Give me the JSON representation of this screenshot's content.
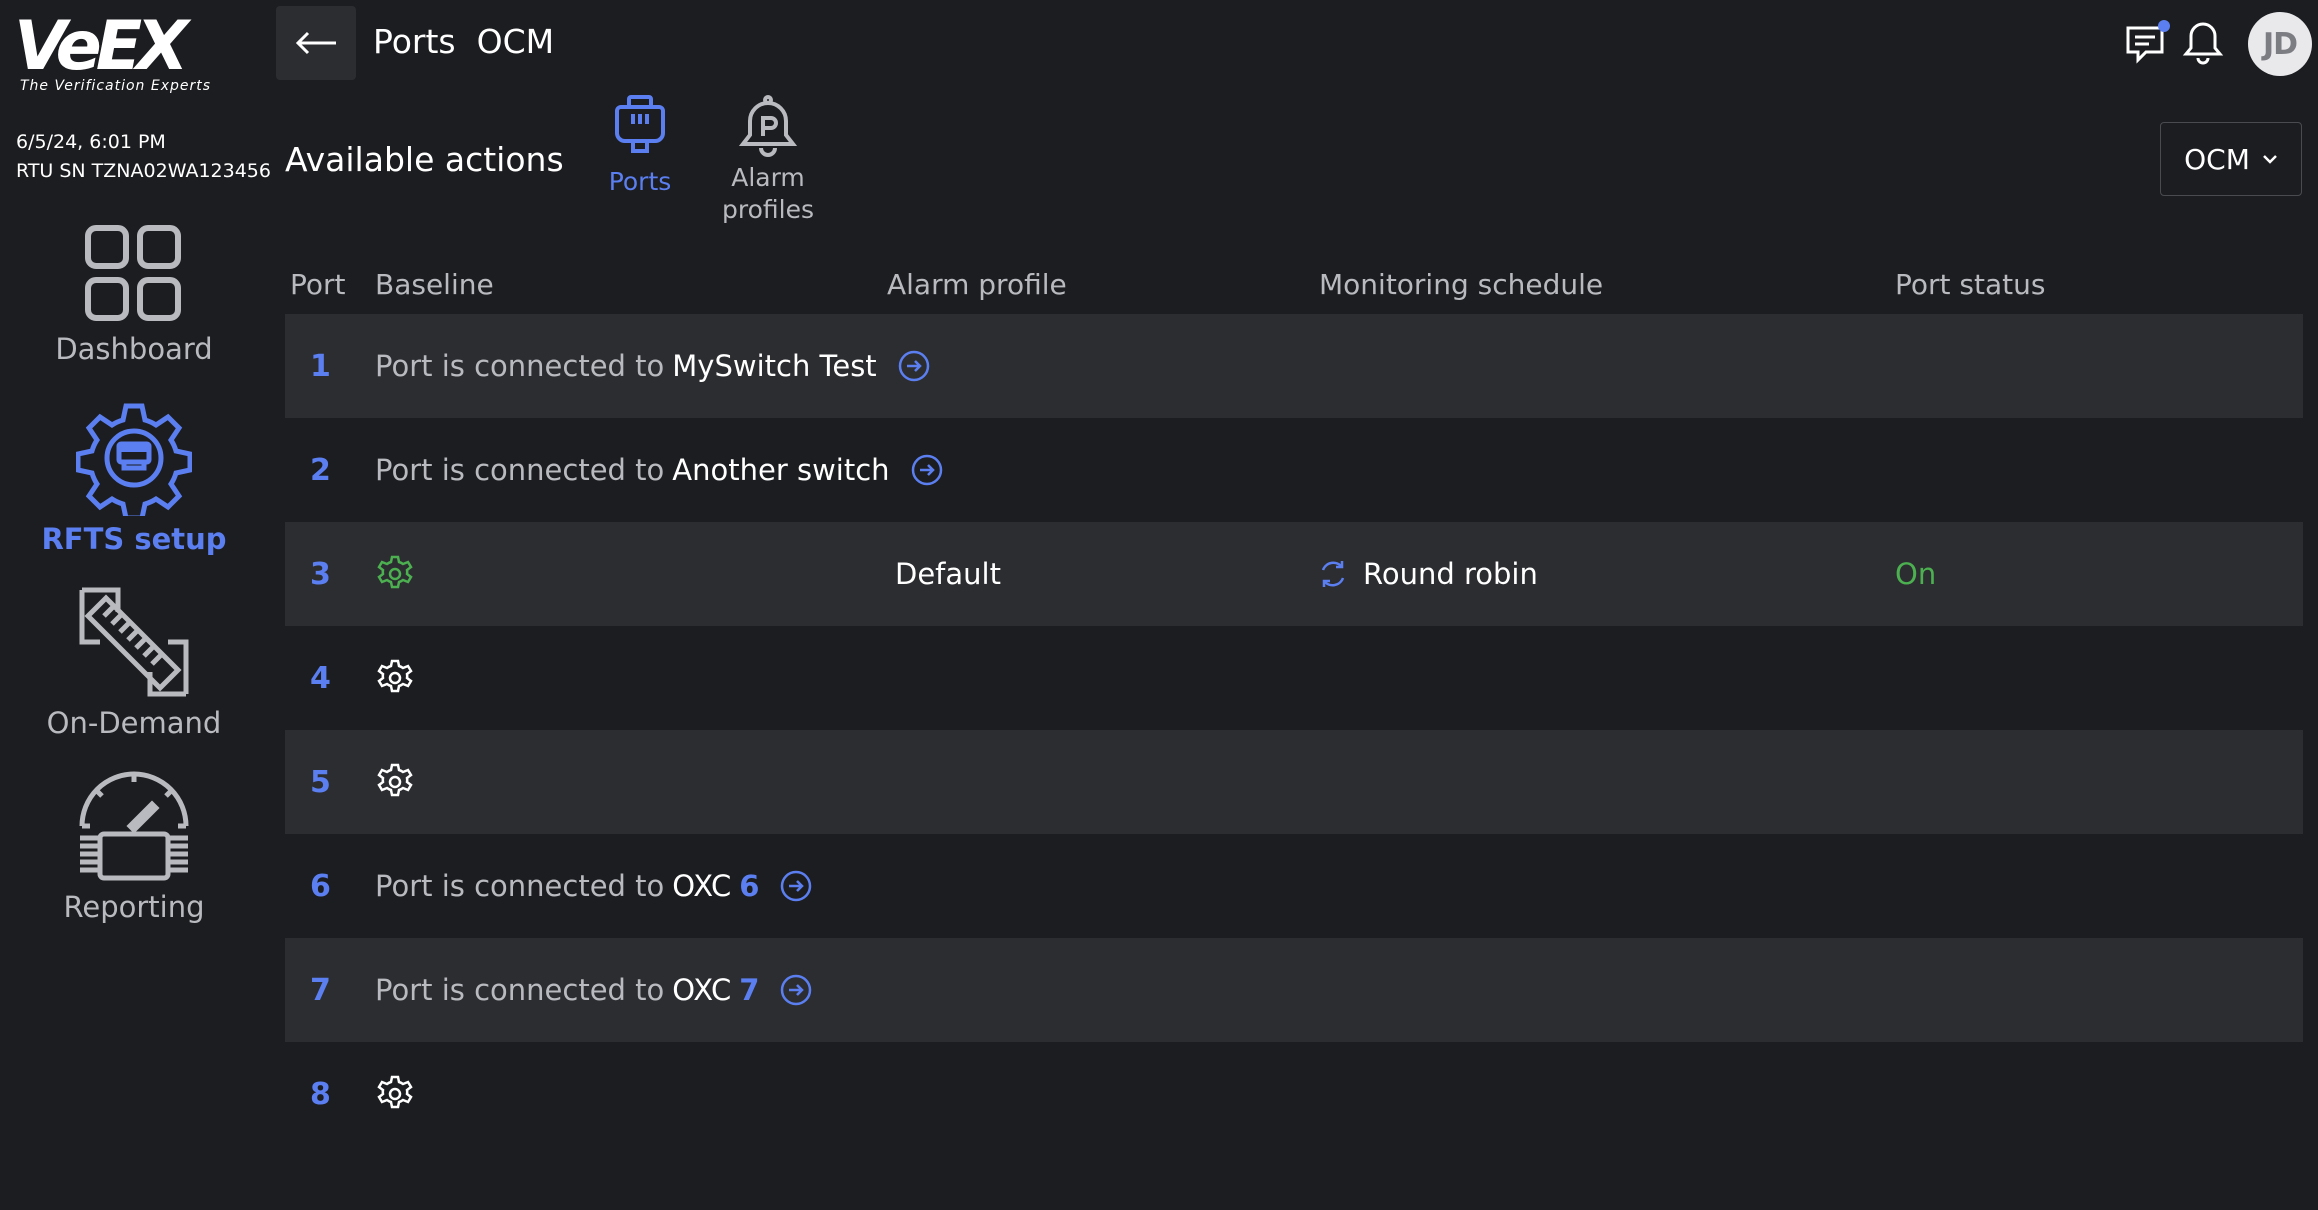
{
  "sidebar": {
    "logo_text": "VeEX",
    "logo_tagline": "The Verification Experts",
    "datetime": "6/5/24, 6:01 PM",
    "serial": "RTU SN TZNA02WA123456",
    "items": [
      {
        "label": "Dashboard",
        "icon": "dashboard-icon"
      },
      {
        "label": "RFTS setup",
        "icon": "rfts-setup-icon",
        "active": true
      },
      {
        "label": "On-Demand",
        "icon": "on-demand-icon"
      },
      {
        "label": "Reporting",
        "icon": "reporting-icon"
      }
    ]
  },
  "header": {
    "back_icon": "arrow-left-icon",
    "title": "Ports  OCM",
    "avatar_initials": "JD",
    "icons": [
      "chat-icon",
      "bell-icon"
    ]
  },
  "actions": {
    "title": "Available actions",
    "ports_label": "Ports",
    "alarm_label_line1": "Alarm",
    "alarm_label_line2": "profiles",
    "select_value": "OCM"
  },
  "table": {
    "columns": {
      "port": "Port",
      "baseline": "Baseline",
      "alarm_profile": "Alarm profile",
      "schedule": "Monitoring schedule",
      "status": "Port status"
    },
    "connected_prefix": "Port is connected to",
    "rows": [
      {
        "port": "1",
        "target": "MySwitch Test",
        "target_num": ""
      },
      {
        "port": "2",
        "target": "Another switch",
        "target_num": ""
      },
      {
        "port": "3",
        "alarm_profile": "Default",
        "schedule": "Round robin",
        "status": "On"
      },
      {
        "port": "4"
      },
      {
        "port": "5"
      },
      {
        "port": "6",
        "target": "OXC",
        "target_num": "6"
      },
      {
        "port": "7",
        "target": "OXC",
        "target_num": "7"
      },
      {
        "port": "8"
      }
    ]
  },
  "colors": {
    "accent": "#5b7ff0",
    "status_on": "#4caf50",
    "gear_configured": "#4caf50",
    "background": "#1c1d20",
    "row_shade": "#2c2d31"
  }
}
